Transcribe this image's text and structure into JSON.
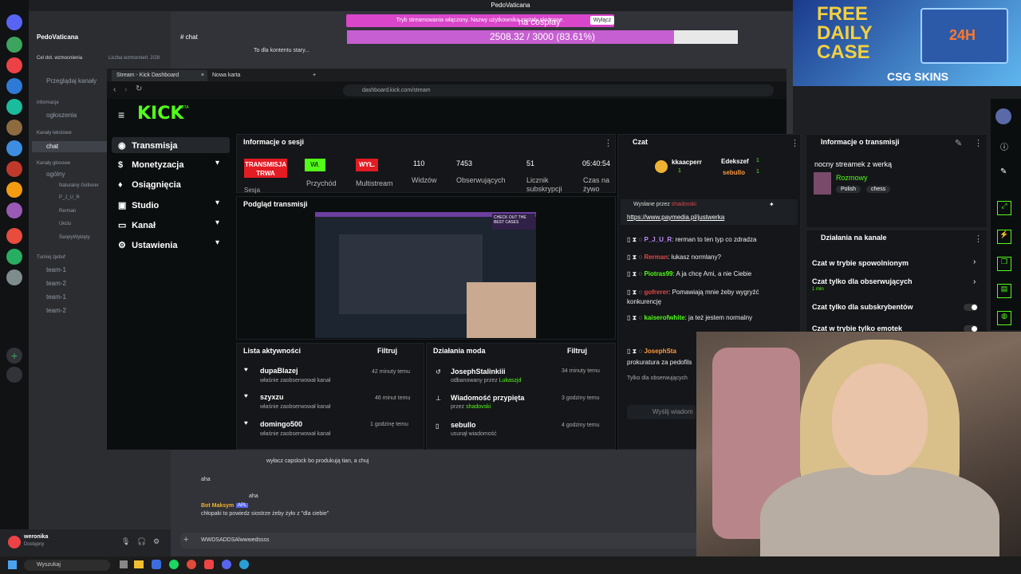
{
  "window": {
    "title": "PedoVaticana"
  },
  "stream_banner": {
    "text": "Tryb streamowania włączony. Nazwy użytkownika zostały skrócone.",
    "button": "Wyłącz"
  },
  "overlay": {
    "cosplay": "na cosplay",
    "progress_text": "2508.32 / 3000 (83.61%)",
    "progress_fraction": 0.8361
  },
  "ad": {
    "title": "FREE DAILY CASE",
    "badge": "24H",
    "logo": "CSG SKINS"
  },
  "discord": {
    "server_name": "PedoVaticana",
    "boost": "Cel dot. wzmocnienia",
    "boost_count": "Liczba wzmocnień: 2/28",
    "browse": "Przeglądaj kanały",
    "cat_info": "informacje",
    "chan_ogloszenia": "ogłoszenia",
    "cat_text": "Kanały tekstowe",
    "chan_chat": "chat",
    "cat_voice": "Kanały głosowe",
    "chan_ogolny": "ogólny",
    "voice_users": [
      "Naturalny Gofrerer",
      "P_J_U_R",
      "Rerman",
      "Ukclu",
      "ŚwiętyWyklęty"
    ],
    "cat_tournament": "Turniej zjebuf",
    "teams": [
      "team-1",
      "team-2",
      "team-1",
      "team-2"
    ],
    "header_channel": "chat",
    "top_msg": "To dla kontentu stary...",
    "msg1": "wyłacz capslock bo produkują tian, a chuj",
    "msg1_reply": "aha",
    "msg2_reply": "aha",
    "msg2_author": "Bot Maksym",
    "msg2_tag": "APL",
    "msg2_text": "chłopaki to powiedz siostrze żeby żyło z \"dla ciebie\"",
    "input_text": "WWDSADDSAlwwwedssss",
    "user_name": "weronika",
    "user_status": "Dostępny"
  },
  "browser": {
    "tab1": "Stream - Kick Dashboard",
    "tab2": "Nowa karta",
    "url": "dashboard.kick.com/stream"
  },
  "kick": {
    "logo": "KICK",
    "beta": "BETA",
    "menu": [
      "Transmisja",
      "Monetyzacja",
      "Osiągnięcia",
      "Studio",
      "Kanał",
      "Ustawienia"
    ],
    "session_title": "Informacje o sesji",
    "live_badge": "TRANSMISJA TRWA",
    "live_sub": "Sesja",
    "income_badge": "Wł.",
    "income_label": "Przychód",
    "multistream_badge": "WYŁ.",
    "multistream_label": "Multistream",
    "viewers": "110",
    "viewers_label": "Widzów",
    "followers": "7453",
    "followers_label": "Obserwujących",
    "subs": "51",
    "subs_label": "Licznik subskrypcji",
    "time": "05:40:54",
    "time_label": "Czas na żywo",
    "preview_title": "Podgląd transmisji",
    "preview_card": "CHECK OUT THE BEST CASES",
    "activity_title": "Lista aktywności",
    "activity_filter": "Filtruj",
    "activities": [
      {
        "name": "dupaBlazej",
        "desc": "właśnie zaobserwował kanał",
        "time": "42 minuty temu"
      },
      {
        "name": "szyxzu",
        "desc": "właśnie zaobserwował kanał",
        "time": "46 minut temu"
      },
      {
        "name": "domingo500",
        "desc": "właśnie zaobserwował kanał",
        "time": "1 godzinę temu"
      }
    ],
    "mod_title": "Działania moda",
    "mod_filter": "Filtruj",
    "mods": [
      {
        "name": "JosephStalinkiii",
        "desc": "odbanowany przez",
        "by": "Lukaszjd",
        "time": "34 minuty temu"
      },
      {
        "name": "Wiadomość przypięta",
        "desc": "przez",
        "by": "shadovski",
        "time": "3 godziny temu"
      },
      {
        "name": "sebullo",
        "desc": "usunął wiadomość",
        "by": "",
        "time": "4 godziny temu"
      }
    ],
    "chat_title": "Czat",
    "top_chatters": [
      "kkaacperr",
      "Edekszef",
      "sebullo"
    ],
    "top_counts": [
      "1",
      "1",
      "1"
    ],
    "pinned_by": "Wysłane przez",
    "pinned_user": "shadovski",
    "pinned_link": "https://www.paymedia.pl/justwerka",
    "chat": [
      {
        "user": "P_J_U_R",
        "text": "rerman to ten typ co zdradza"
      },
      {
        "user": "Rerman",
        "text": "łukasz normlany?"
      },
      {
        "user": "Piotras99",
        "text": "A ja chcę Ami, a nie Ciebie"
      },
      {
        "user": "gofrerer",
        "text": "Pomawiają mnie żeby wygryźć konkurencję"
      },
      {
        "user": "kaiserofwhite",
        "text": "ja też jestem normalny"
      },
      {
        "user": "JosephSta",
        "text": ""
      }
    ],
    "chat_extra": "prokuratura za pedofils",
    "chat_followers": "Tylko dla obserwujących",
    "chat_input": "Wyślij wiadom",
    "info_title": "Informacje o transmisji",
    "stream_title": "nocny streamek z werką",
    "category": "Rozmowy",
    "tags": [
      "Polish",
      "chess"
    ],
    "actions_title": "Działania na kanale",
    "actions": [
      "Czat w trybie spowolnionym",
      "Czat tylko dla obserwujących",
      "Czat tylko dla subskrybentów",
      "Czat w trybie tylko emotek"
    ],
    "followers_sub": "1 min"
  },
  "taskbar": {
    "search": "Wyszukaj"
  }
}
